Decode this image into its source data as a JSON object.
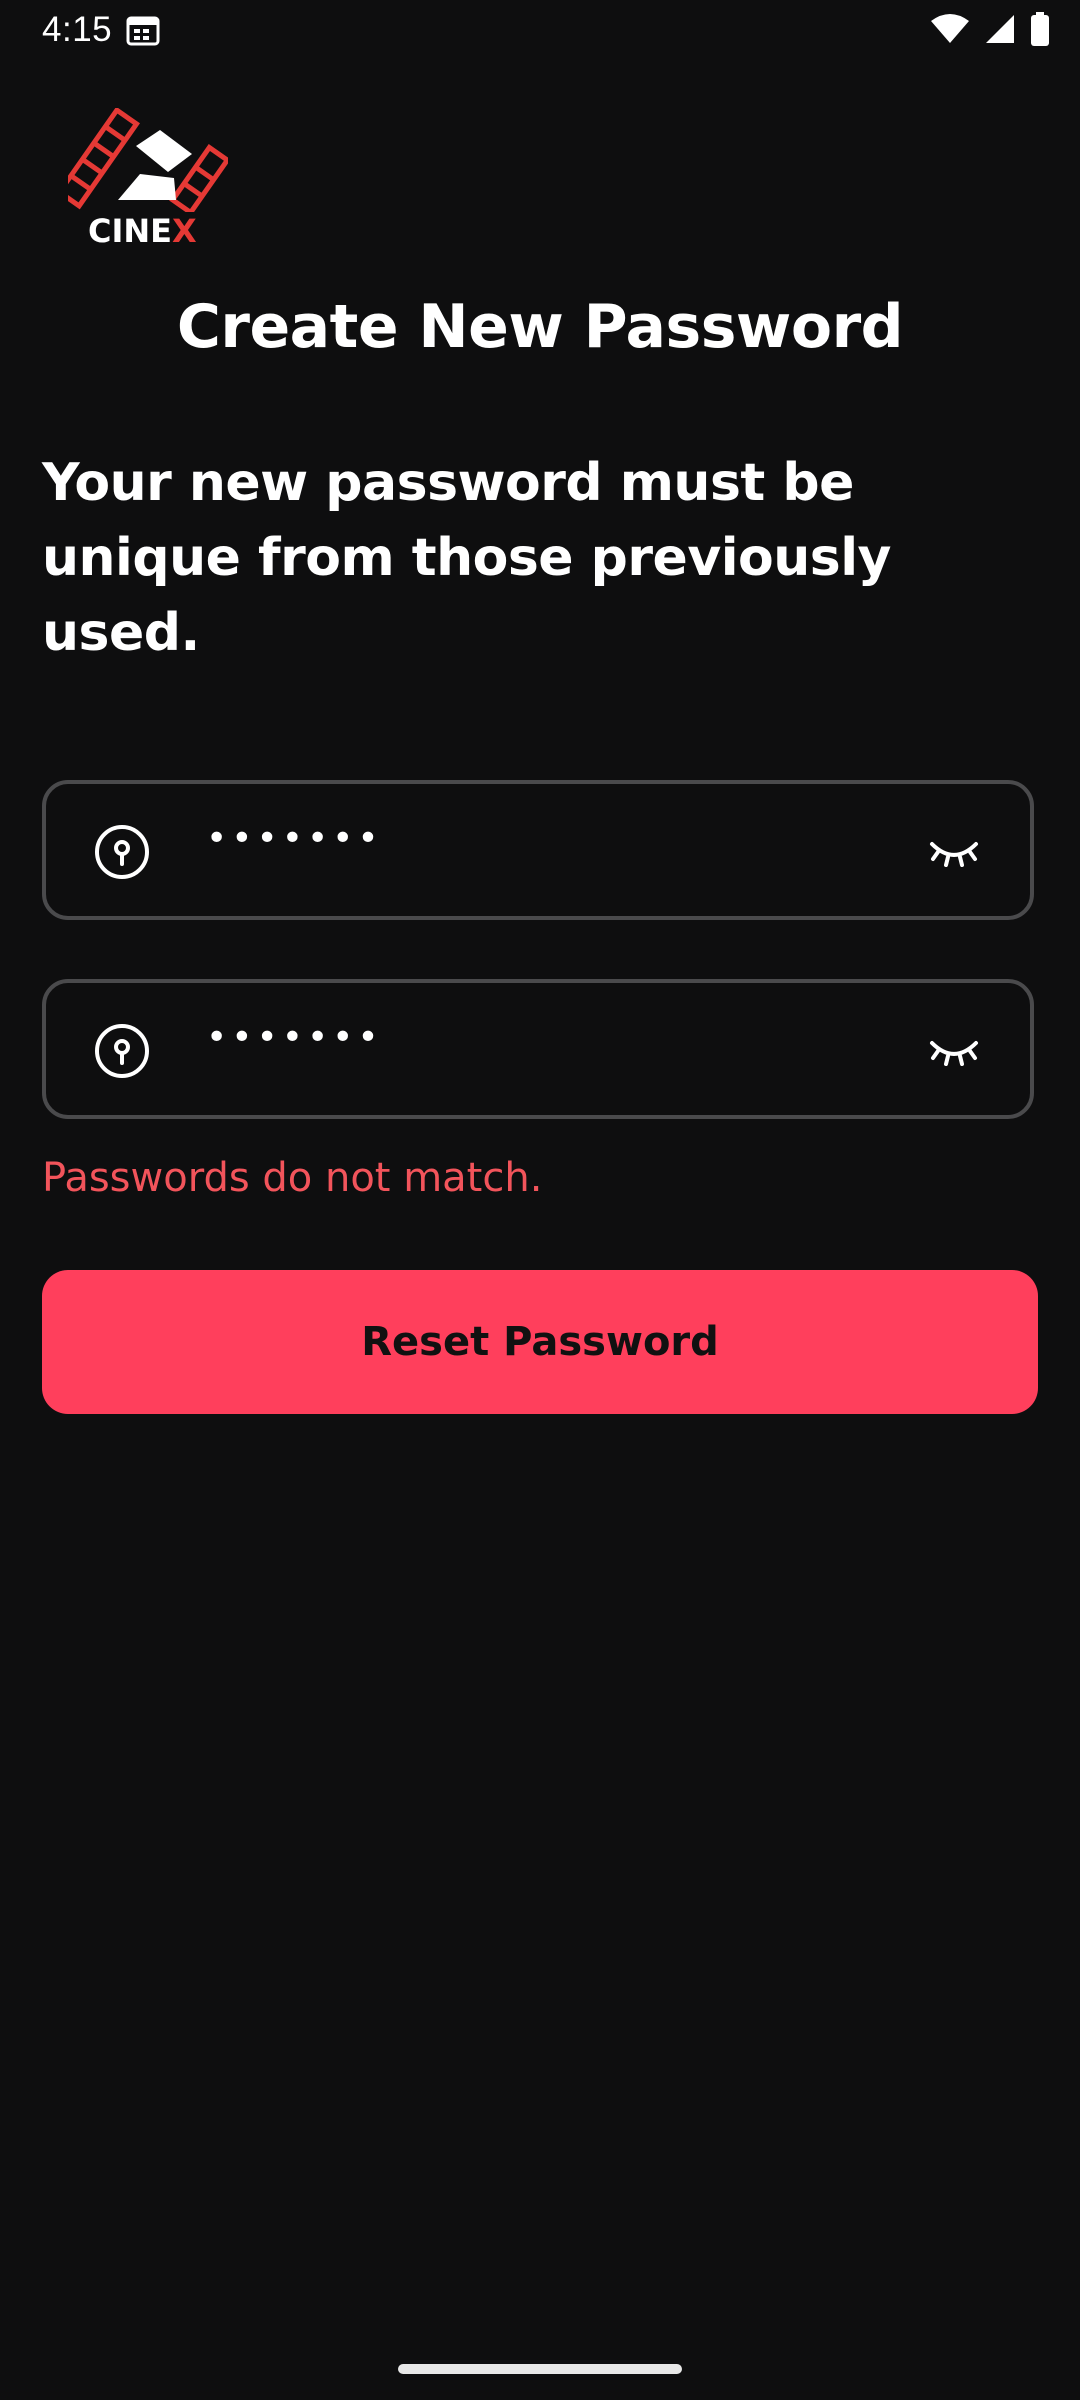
{
  "status_bar": {
    "time": "4:15"
  },
  "brand": {
    "logo_text_main": "CINE",
    "logo_text_accent": "X",
    "accent_color": "#e53935"
  },
  "page": {
    "title": "Create New Password",
    "subtitle": "Your new password must be unique from those previously used."
  },
  "form": {
    "password": {
      "value": "•••••••",
      "leading_icon": "key-icon",
      "trailing_icon": "eye-closed-icon"
    },
    "confirm_password": {
      "value": "•••••••",
      "leading_icon": "key-icon",
      "trailing_icon": "eye-closed-icon"
    },
    "error": "Passwords do not match.",
    "error_color": "#f2545b"
  },
  "actions": {
    "reset_label": "Reset Password",
    "button_color": "#ff3f5c"
  }
}
